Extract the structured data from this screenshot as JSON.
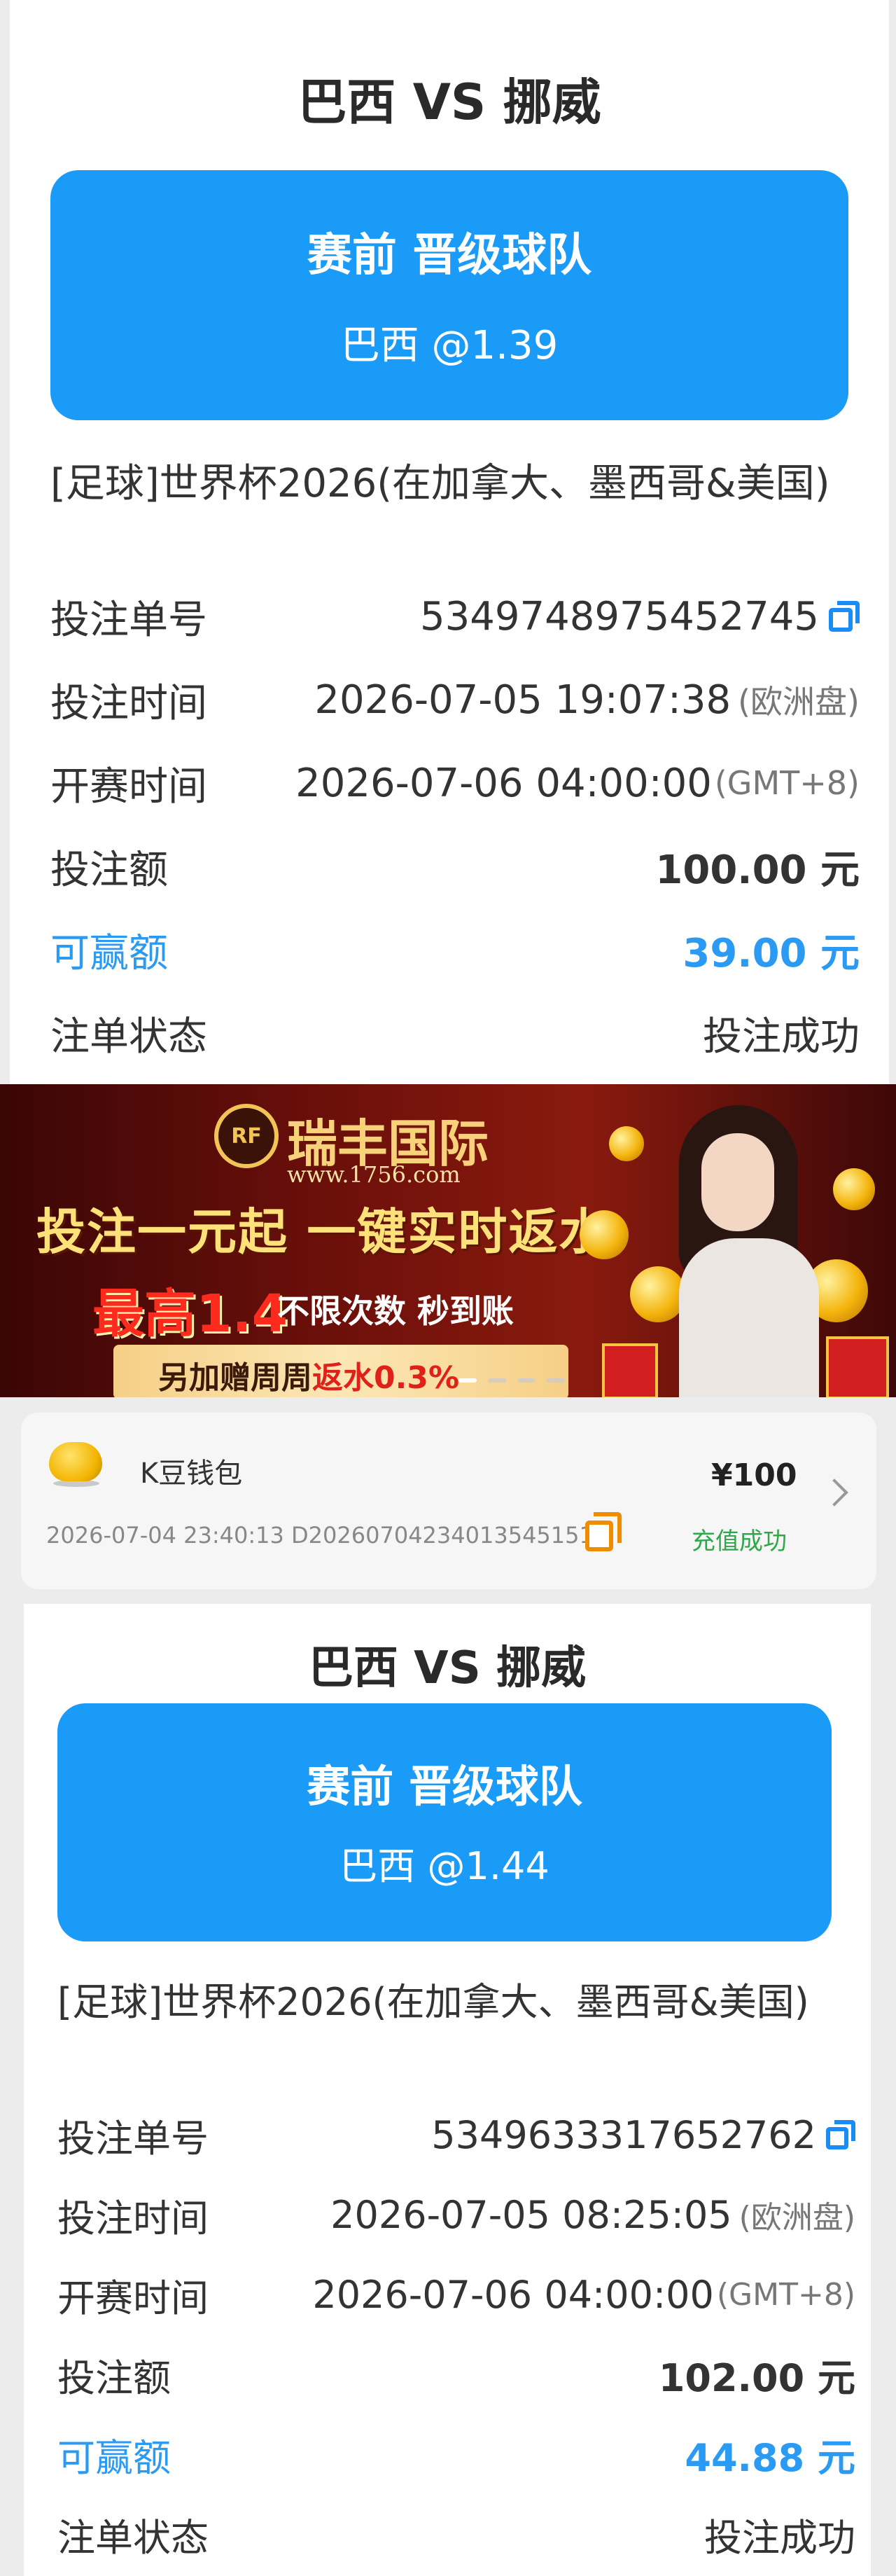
{
  "bets": [
    {
      "match_title": "巴西 VS 挪威",
      "bet_type": "赛前 晋级球队",
      "pick": "巴西   @1.39",
      "league": "[足球]世界杯2026(在加拿大、墨西哥&美国)",
      "fields": {
        "order_no": {
          "label": "投注单号",
          "value": "5349748975452745"
        },
        "bet_time": {
          "label": "投注时间",
          "value": "2026-07-05 19:07:38",
          "note": "(欧洲盘)"
        },
        "start_time": {
          "label": "开赛时间",
          "value": "2026-07-06 04:00:00",
          "note": "(GMT+8)"
        },
        "stake": {
          "label": "投注额",
          "value": "100.00 元"
        },
        "win": {
          "label": "可赢额",
          "value": "39.00 元"
        },
        "status": {
          "label": "注单状态",
          "value": "投注成功"
        }
      }
    },
    {
      "match_title": "巴西 VS 挪威",
      "bet_type": "赛前 晋级球队",
      "pick": "巴西   @1.44",
      "league": "[足球]世界杯2026(在加拿大、墨西哥&美国)",
      "fields": {
        "order_no": {
          "label": "投注单号",
          "value": "5349633317652762"
        },
        "bet_time": {
          "label": "投注时间",
          "value": "2026-07-05 08:25:05",
          "note": "(欧洲盘)"
        },
        "start_time": {
          "label": "开赛时间",
          "value": "2026-07-06 04:00:00",
          "note": "(GMT+8)"
        },
        "stake": {
          "label": "投注额",
          "value": "102.00 元"
        },
        "win": {
          "label": "可赢额",
          "value": "44.88 元"
        },
        "status": {
          "label": "注单状态",
          "value": "投注成功"
        }
      }
    }
  ],
  "banner": {
    "logo": "RF",
    "brand": "瑞丰国际",
    "site": "www.1756.com",
    "headline": "投注一元起 一键实时返水",
    "max_rebate": "最高1.4",
    "unlimited": "不限次数 秒到账",
    "extra_prefix": "另加赠周周",
    "extra_highlight": "返水0.3%"
  },
  "wallet": {
    "name": "K豆钱包",
    "meta": "2026-07-04 23:40:13 D202607042340135451511",
    "amount": "¥100",
    "status": "充值成功"
  },
  "colors": {
    "card_blue": "#1a9bf7",
    "win_blue": "#2b9af3",
    "success_green": "#2ea84b",
    "copy_orange": "#f08c00"
  }
}
